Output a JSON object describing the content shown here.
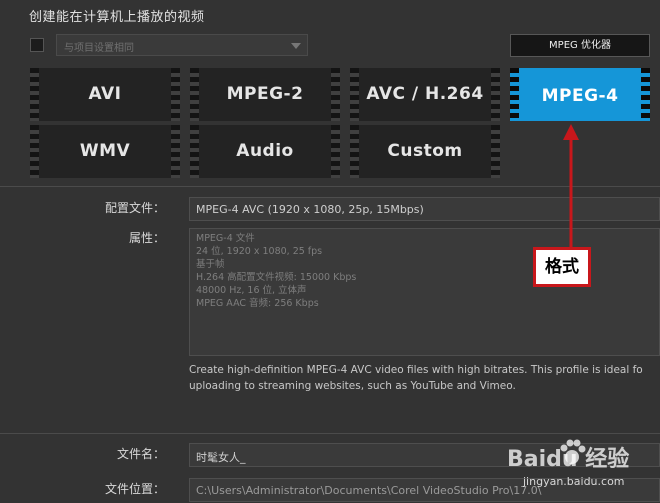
{
  "section_title": "创建能在计算机上播放的视频",
  "match_project_dropdown": {
    "value": "与项目设置相同"
  },
  "optimizer_button": {
    "label": "MPEG 优化器"
  },
  "formats": [
    {
      "label": "AVI",
      "selected": false
    },
    {
      "label": "MPEG-2",
      "selected": false
    },
    {
      "label": "AVC / H.264",
      "selected": false
    },
    {
      "label": "MPEG-4",
      "selected": true
    },
    {
      "label": "WMV",
      "selected": false
    },
    {
      "label": "Audio",
      "selected": false
    },
    {
      "label": "Custom",
      "selected": false
    }
  ],
  "profile": {
    "label": "配置文件：",
    "value": "MPEG-4 AVC (1920 x 1080, 25p, 15Mbps)"
  },
  "properties": {
    "label": "属性：",
    "lines": [
      "MPEG-4 文件",
      "24 位, 1920 x 1080, 25 fps",
      "基于帧",
      "H.264 高配置文件视频: 15000 Kbps",
      "48000 Hz, 16 位, 立体声",
      "MPEG AAC 音频: 256 Kbps"
    ]
  },
  "description": {
    "line1": "Create high-definition MPEG-4 AVC video files with high bitrates. This profile is ideal fo",
    "line2": "uploading to streaming websites, such as YouTube and Vimeo."
  },
  "file_name": {
    "label": "文件名：",
    "value": "时髦女人_"
  },
  "file_location": {
    "label": "文件位置：",
    "value": "C:\\Users\\Administrator\\Documents\\Corel VideoStudio Pro\\17.0\\"
  },
  "annotation": {
    "text": "格式",
    "color": "#c8171b"
  },
  "watermark": {
    "text": "Baidu 经验",
    "url": "jingyan.baidu.com"
  },
  "colors": {
    "selected_tile": "#1596d8",
    "background": "#333333"
  }
}
